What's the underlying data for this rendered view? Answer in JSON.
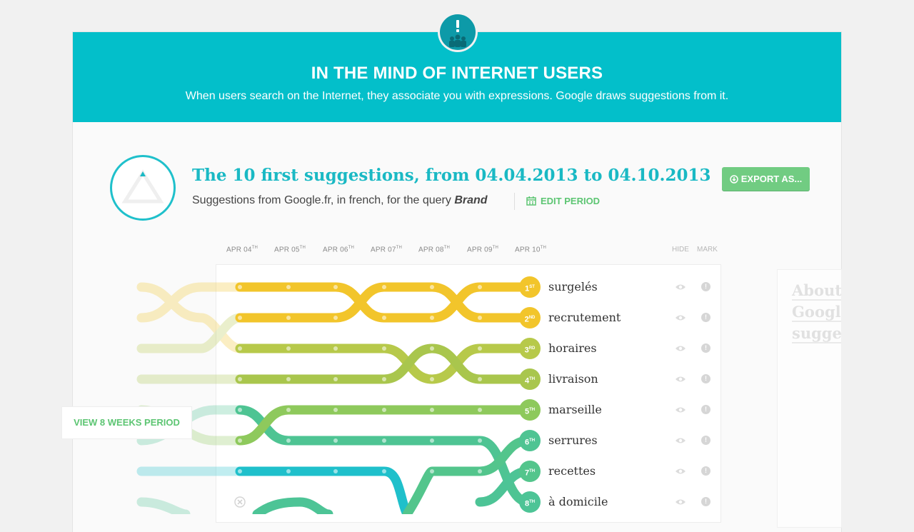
{
  "banner": {
    "title": "IN THE MIND OF INTERNET USERS",
    "subtitle": "When users search on the Internet, they associate you with expressions. Google draws suggestions from it.",
    "badge_icon": "alert-people-icon"
  },
  "header": {
    "title": "The 10 first suggestions, from 04.04.2013 to 04.10.2013",
    "subtitle_prefix": "Suggestions from Google.fr, in french, for the query",
    "query": "Brand",
    "edit_period_label": "EDIT PERIOD",
    "export_label": "EXPORT AS..."
  },
  "dates": [
    {
      "label": "APR 04",
      "suffix": "TH"
    },
    {
      "label": "APR 05",
      "suffix": "TH"
    },
    {
      "label": "APR 06",
      "suffix": "TH"
    },
    {
      "label": "APR 07",
      "suffix": "TH"
    },
    {
      "label": "APR 08",
      "suffix": "TH"
    },
    {
      "label": "APR 09",
      "suffix": "TH"
    },
    {
      "label": "APR 10",
      "suffix": "TH"
    }
  ],
  "columns": {
    "hide": "HIDE",
    "mark": "MARK"
  },
  "suggestions": [
    {
      "rank": "1",
      "suffix": "ST",
      "term": "surgelés",
      "color": "#f2c52b"
    },
    {
      "rank": "2",
      "suffix": "ND",
      "term": "recrutement",
      "color": "#f2c52b"
    },
    {
      "rank": "3",
      "suffix": "RD",
      "term": "horaires",
      "color": "#b7c94a"
    },
    {
      "rank": "4",
      "suffix": "TH",
      "term": "livraison",
      "color": "#a9c64d"
    },
    {
      "rank": "5",
      "suffix": "TH",
      "term": "marseille",
      "color": "#8ec95c"
    },
    {
      "rank": "6",
      "suffix": "TH",
      "term": "serrures",
      "color": "#4ec493"
    },
    {
      "rank": "7",
      "suffix": "TH",
      "term": "recettes",
      "color": "#53c58c"
    },
    {
      "rank": "8",
      "suffix": "TH",
      "term": "à domicile",
      "color": "#4dc496"
    }
  ],
  "weeks_button": "VIEW 8 WEEKS PERIOD",
  "about": [
    "About",
    "Google",
    "sugges"
  ]
}
